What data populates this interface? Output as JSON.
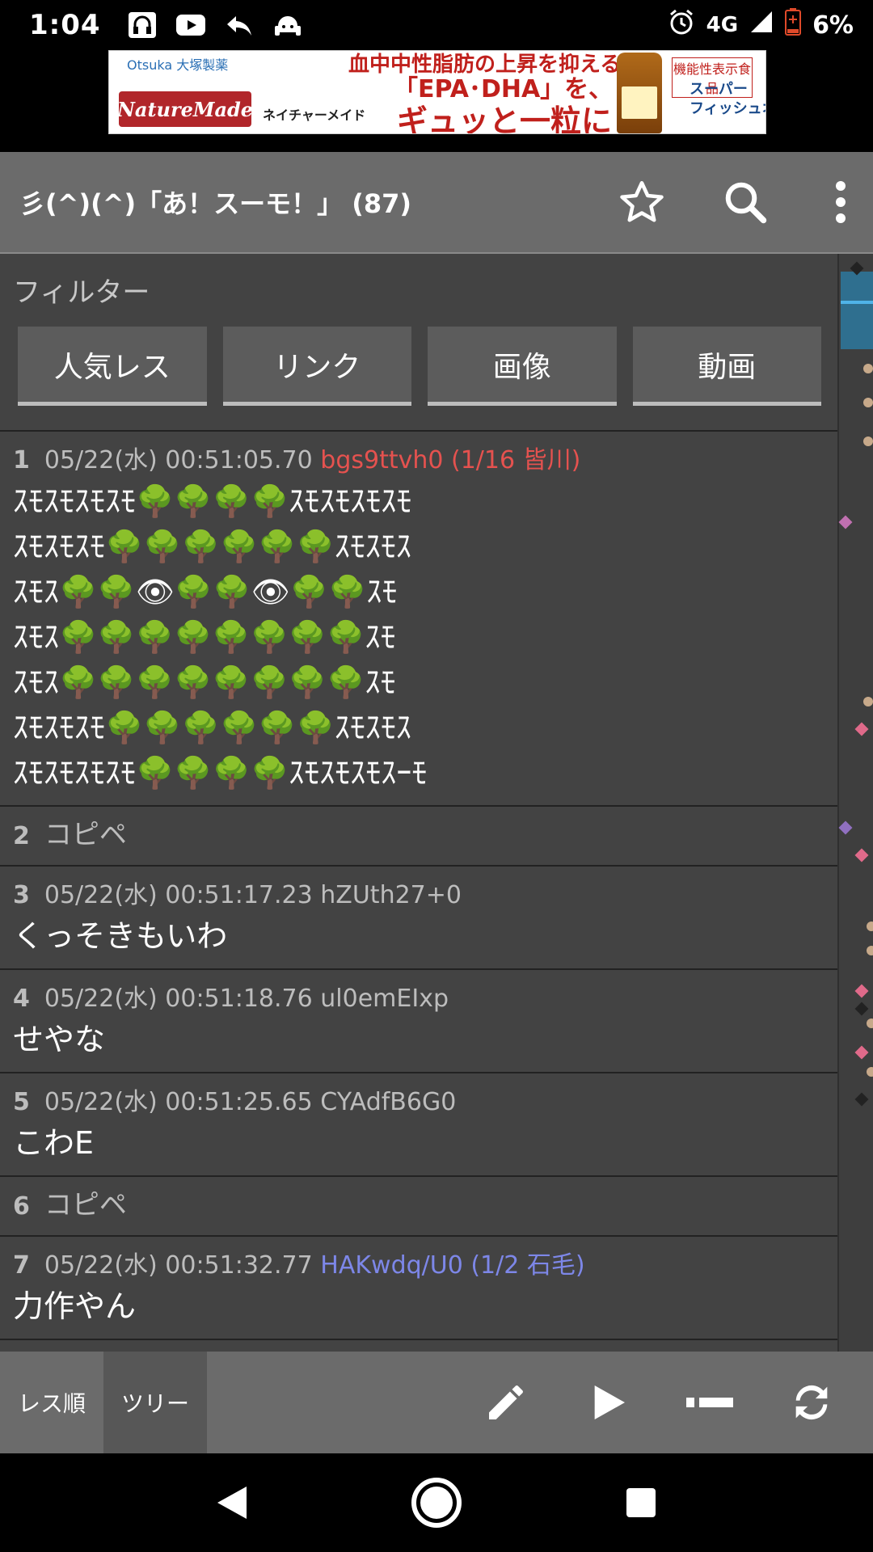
{
  "status_bar": {
    "time": "1:04",
    "network": "4G",
    "battery": "6%",
    "left_icons": [
      "headphones-icon",
      "youtube-icon",
      "reply-arrow-icon",
      "android-headset-icon"
    ],
    "right_icons": [
      "alarm-icon",
      "signal-icon",
      "battery-low-icon"
    ]
  },
  "ad": {
    "brand_small": "Otsuka 大塚製薬",
    "logo": "NatureMade",
    "logo_sub": "ネイチャーメイド",
    "headline1": "血中中性脂肪の上昇を抑える",
    "headline2": "「EPA･DHA」を、",
    "headline3": "ギュッと一粒に",
    "tag": "機能性表示食品",
    "product": "スーパー\nフィッシュオイル"
  },
  "toolbar": {
    "title": "彡(^)(^)「あ！スーモ！」 (87)"
  },
  "filter": {
    "label": "フィルター",
    "buttons": [
      "人気レス",
      "リンク",
      "画像",
      "動画"
    ]
  },
  "posts": [
    {
      "num": "1",
      "date": "05/22(水) 00:51:05.70",
      "id": "bgs9ttvh0 (1/16 皆川)",
      "id_color": "red",
      "lines": [
        "ｽﾓｽﾓｽﾓｽﾓ🌳🌳🌳🌳ｽﾓｽﾓｽﾓｽﾓ",
        "ｽﾓｽﾓｽﾓ🌳🌳🌳🌳🌳🌳ｽﾓｽﾓｽ",
        "ｽﾓｽ🌳🌳👁🌳🌳👁🌳🌳ｽﾓ",
        "ｽﾓｽ🌳🌳🌳🌳🌳🌳🌳🌳ｽﾓ",
        "ｽﾓｽ🌳🌳🌳🌳🌳🌳🌳🌳ｽﾓ",
        "ｽﾓｽﾓｽﾓ🌳🌳🌳🌳🌳🌳ｽﾓｽﾓｽ",
        "ｽﾓｽﾓｽﾓｽﾓ🌳🌳🌳🌳ｽﾓｽﾓｽﾓｽｰﾓ"
      ]
    },
    {
      "num": "2",
      "collapsed": "コピペ"
    },
    {
      "num": "3",
      "date": "05/22(水) 00:51:17.23",
      "id": "hZUth27+0",
      "id_color": "gray",
      "lines": [
        "くっそきもいわ"
      ]
    },
    {
      "num": "4",
      "date": "05/22(水) 00:51:18.76",
      "id": "ul0emEIxp",
      "id_color": "gray",
      "lines": [
        "せやな"
      ]
    },
    {
      "num": "5",
      "date": "05/22(水) 00:51:25.65",
      "id": "CYAdfB6G0",
      "id_color": "gray",
      "lines": [
        "こわE"
      ]
    },
    {
      "num": "6",
      "collapsed": "コピペ"
    },
    {
      "num": "7",
      "date": "05/22(水) 00:51:32.77",
      "id": "HAKwdq/U0 (1/2 石毛)",
      "id_color": "blue",
      "lines": [
        "力作やん"
      ]
    }
  ],
  "bottom_bar": {
    "tabs": [
      "レス順",
      "ツリー"
    ],
    "active_tab": "ツリー",
    "buttons": [
      "pencil-icon",
      "play-icon",
      "minimize-icon",
      "refresh-icon"
    ]
  },
  "colors": {
    "toolbar": "#6b6b6b",
    "content": "#434343",
    "id_red": "#e5524f",
    "id_blue": "#7d87e8"
  }
}
